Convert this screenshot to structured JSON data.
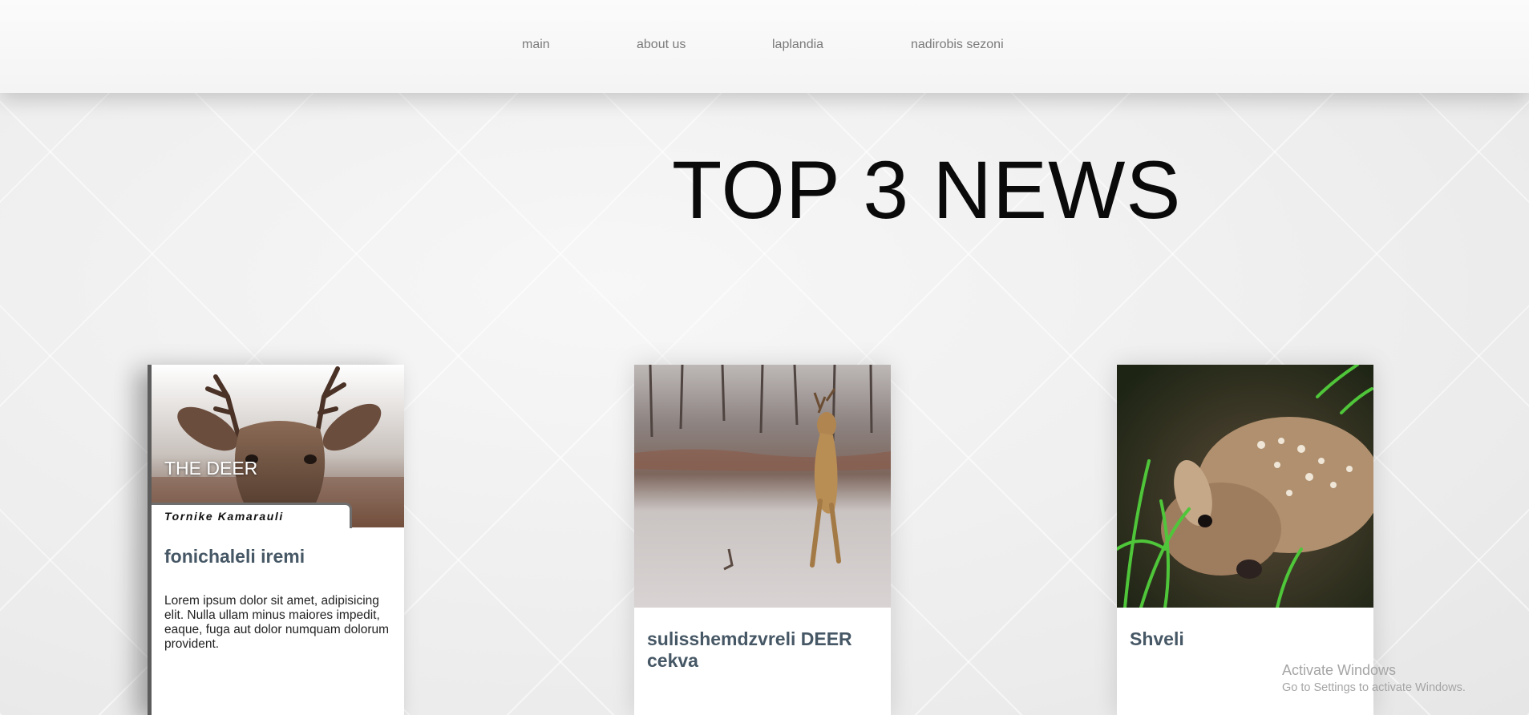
{
  "nav": {
    "items": [
      {
        "label": "main"
      },
      {
        "label": "about us"
      },
      {
        "label": "laplandia"
      },
      {
        "label": "nadirobis sezoni"
      }
    ]
  },
  "hero": {
    "title": "TOP 3 NEWS"
  },
  "cards": [
    {
      "image_subject": "deer-head-photo",
      "overlay_title": "THE DEER",
      "author": "Tornike Kamarauli",
      "title": "fonichaleli iremi",
      "body": "Lorem ipsum dolor sit amet, adipisicing elit. Nulla ullam minus maiores impedit, eaque, fuga aut dolor numquam dolorum provident."
    },
    {
      "image_subject": "deer-jumping-photo",
      "title": "sulisshemdzvreli DEER cekva"
    },
    {
      "image_subject": "fawn-in-grass-photo",
      "title": "Shveli"
    }
  ],
  "watermark": {
    "title": "Activate Windows",
    "subtitle": "Go to Settings to activate Windows."
  },
  "colors": {
    "card_title": "#465765",
    "nav_text": "#7a7a7a",
    "heading": "#0a0a0a"
  }
}
